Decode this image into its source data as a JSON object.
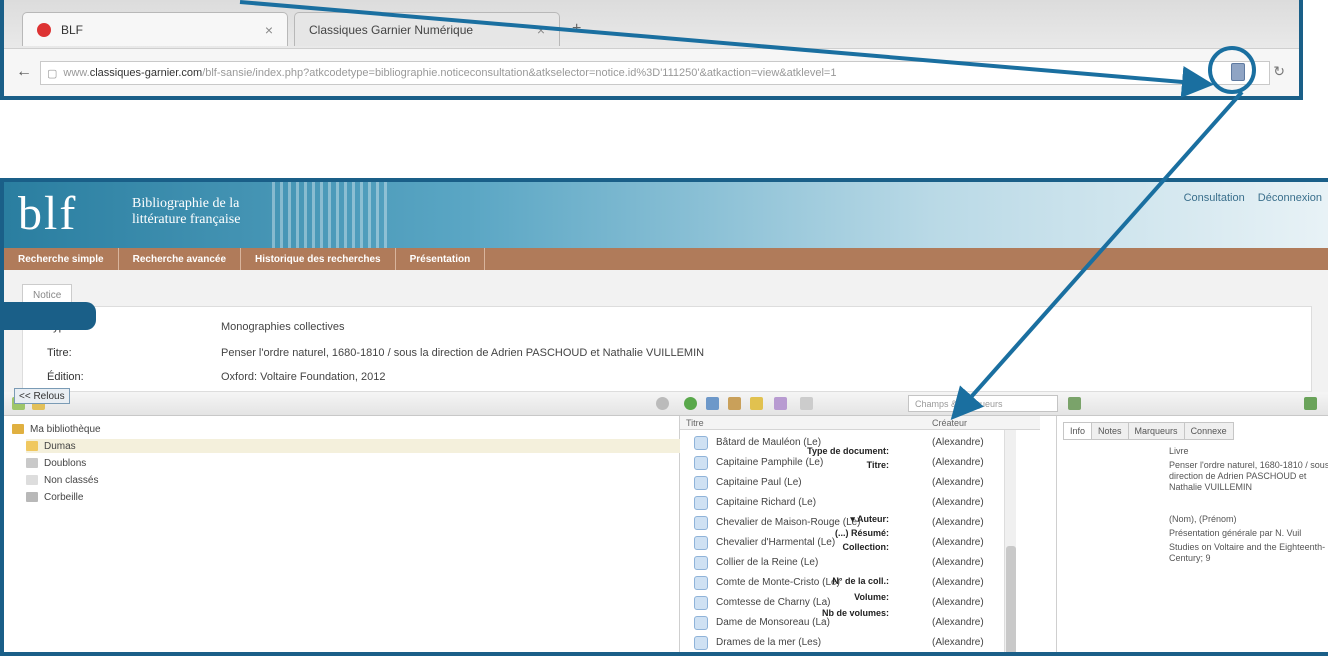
{
  "browser": {
    "tabs": [
      {
        "title": "BLF",
        "close": "×"
      },
      {
        "title": "Classiques Garnier Numérique",
        "close": "×"
      }
    ],
    "new_tab": "+",
    "back": "←",
    "url_prefix": "www.",
    "url_host": "classiques-garnier.com",
    "url_path": "/blf-sansie/index.php?atkcodetype=bibliographie.noticeconsultation&atkselector=notice.id%3D'111250'&atkaction=view&atklevel=1",
    "reload": "↻"
  },
  "app": {
    "logo": "blf",
    "subtitle": "Bibliographie de la\nlittérature française",
    "top_links": [
      "Consultation",
      "Déconnexion"
    ],
    "nav": [
      "Recherche simple",
      "Recherche avancée",
      "Historique des recherches",
      "Présentation"
    ],
    "notice_tab": "Notice",
    "fields": [
      {
        "label": "Type:",
        "value": "Monographies collectives"
      },
      {
        "label": "Titre:",
        "value": "Penser l'ordre naturel, 1680-1810 / sous la direction de Adrien PASCHOUD et Nathalie VUILLEMIN"
      },
      {
        "label": "Édition:",
        "value": "Oxford: Voltaire Foundation, 2012"
      }
    ],
    "relous_button": "<< Relous"
  },
  "library": {
    "search_placeholder": "Champs & Marqueurs",
    "collections": [
      {
        "name": "Ma bibliothèque",
        "color": "#e0b040"
      },
      {
        "name": "Dumas",
        "color": "#f0c860"
      },
      {
        "name": "Doublons",
        "color": "#c9c9c9"
      },
      {
        "name": "Non classés",
        "color": "#dddddd"
      },
      {
        "name": "Corbeille",
        "color": "#b8b8b8"
      }
    ],
    "columns": {
      "title": "Titre",
      "creator": "Créateur"
    },
    "items": [
      {
        "title": "Bâtard de Mauléon (Le)",
        "creator": "(Alexandre)"
      },
      {
        "title": "Capitaine Pamphile (Le)",
        "creator": "(Alexandre)"
      },
      {
        "title": "Capitaine Paul (Le)",
        "creator": "(Alexandre)"
      },
      {
        "title": "Capitaine Richard (Le)",
        "creator": "(Alexandre)"
      },
      {
        "title": "Chevalier de Maison-Rouge (Le)",
        "creator": "(Alexandre)"
      },
      {
        "title": "Chevalier d'Harmental (Le)",
        "creator": "(Alexandre)"
      },
      {
        "title": "Collier de la Reine (Le)",
        "creator": "(Alexandre)"
      },
      {
        "title": "Comte de Monte-Cristo (Le)",
        "creator": "(Alexandre)"
      },
      {
        "title": "Comtesse de Charny (La)",
        "creator": "(Alexandre)"
      },
      {
        "title": "Dame de Monsoreau (La)",
        "creator": "(Alexandre)"
      },
      {
        "title": "Drames de la mer (Les)",
        "creator": "(Alexandre)"
      }
    ],
    "right_tabs": [
      "Info",
      "Notes",
      "Marqueurs",
      "Connexe"
    ],
    "info": [
      {
        "label": "Type de document:",
        "value": "Livre"
      },
      {
        "label": "Titre:",
        "value": "Penser l'ordre naturel, 1680-1810 / sous la direction de Adrien PASCHOUD et Nathalie VUILLEMIN"
      },
      {
        "label": "▾ Auteur:",
        "value": "(Nom), (Prénom)"
      },
      {
        "label": "(...) Résumé:",
        "value": "Présentation générale par N. Vuil"
      },
      {
        "label": "Collection:",
        "value": "Studies on Voltaire and the Eighteenth-Century; 9"
      },
      {
        "label": "N° de la coll.:",
        "value": ""
      },
      {
        "label": "Volume:",
        "value": ""
      },
      {
        "label": "Nb de volumes:",
        "value": ""
      }
    ]
  }
}
